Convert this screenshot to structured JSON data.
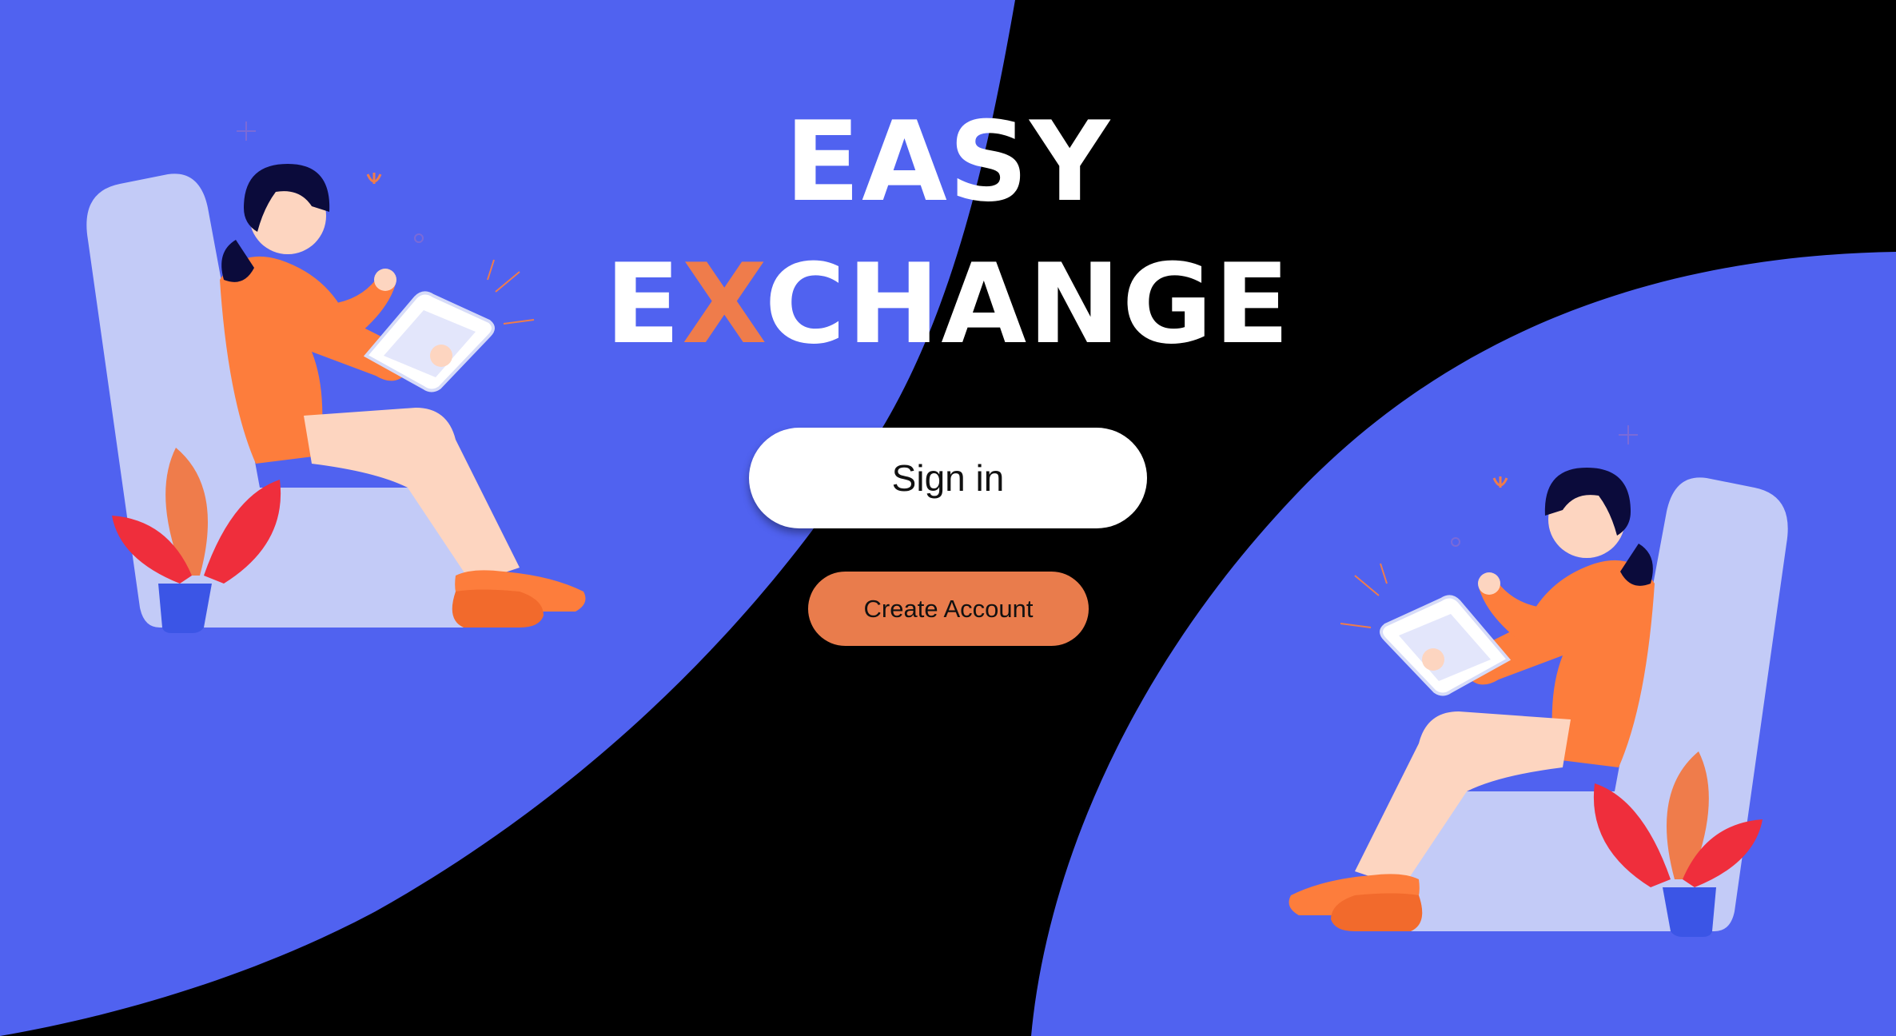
{
  "title": {
    "line1": "EASY",
    "line2_part1": "E",
    "line2_accent": "X",
    "line2_part2": "CHANGE"
  },
  "buttons": {
    "sign_in_label": "Sign in",
    "create_account_label": "Create Account"
  },
  "illustrations": {
    "left": "woman-sitting-with-tablet-icon",
    "right": "woman-sitting-with-tablet-icon"
  },
  "colors": {
    "background": "#000000",
    "blue_shape": "#5062f0",
    "accent_orange": "#ef7c4b",
    "create_button": "#e97c4c",
    "sign_in_button": "#ffffff",
    "chair": "#c3cbf7"
  }
}
